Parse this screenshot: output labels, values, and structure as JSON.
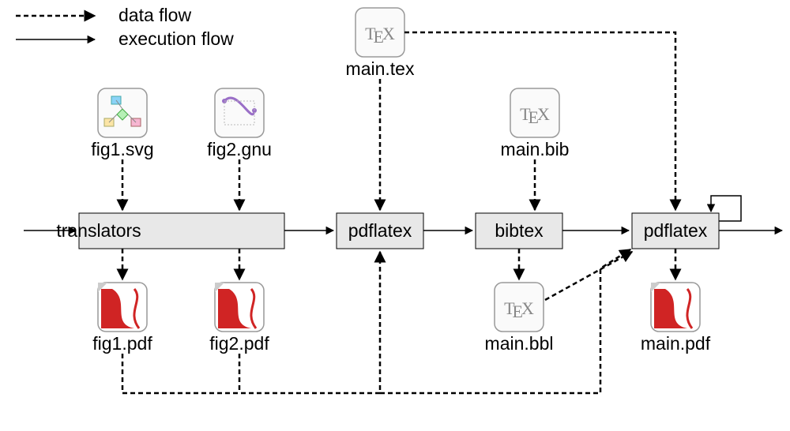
{
  "legend": {
    "data_flow": "data flow",
    "execution_flow": "execution flow"
  },
  "files": {
    "main_tex": "main.tex",
    "fig1_svg": "fig1.svg",
    "fig2_gnu": "fig2.gnu",
    "main_bib": "main.bib",
    "fig1_pdf": "fig1.pdf",
    "fig2_pdf": "fig2.pdf",
    "main_bbl": "main.bbl",
    "main_pdf": "main.pdf"
  },
  "processes": {
    "translators": "translators",
    "pdflatex1": "pdflatex",
    "bibtex": "bibtex",
    "pdflatex2": "pdflatex"
  }
}
